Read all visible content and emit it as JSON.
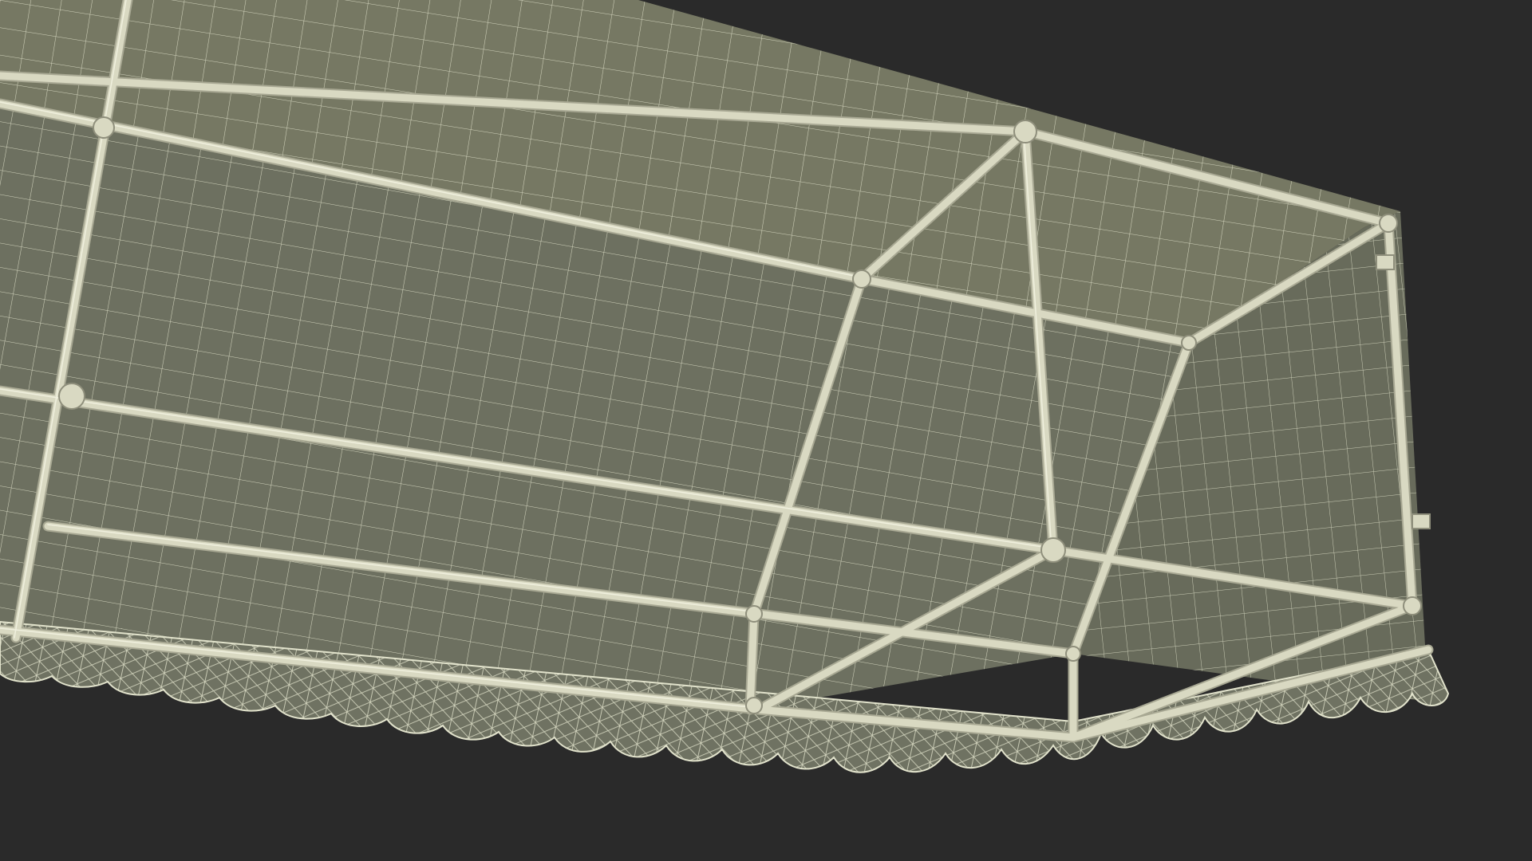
{
  "scene": {
    "subject": "wireframe-awning-frame",
    "colors": {
      "background": "#2a2a2a",
      "fabric_top": "#767863",
      "fabric_front": "#6d7060",
      "fabric_side": "#686b5b",
      "wire": "#e2e3cc",
      "frame_fill": "#d9d9c2",
      "frame_edge": "#a8a893"
    }
  }
}
